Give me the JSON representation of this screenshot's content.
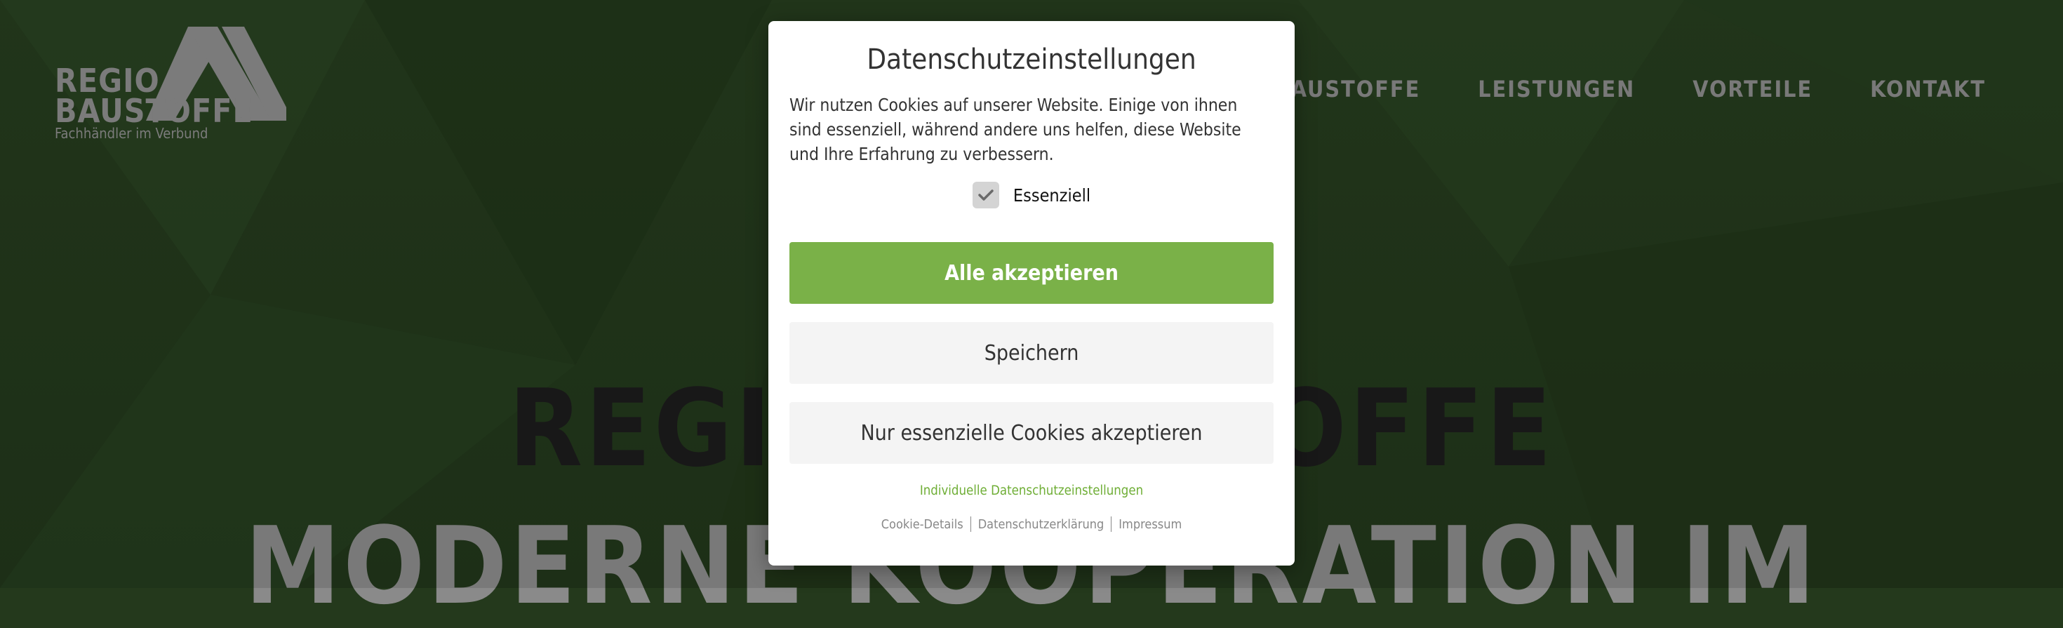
{
  "logo": {
    "line1": "REGIO",
    "line2": "BAUSTOFFE",
    "tagline": "Fachhändler im Verbund",
    "icon": "double-roof-chevron-logo"
  },
  "nav": {
    "items": [
      {
        "label": "REGIO BAUSTOFFE"
      },
      {
        "label": "LEISTUNGEN"
      },
      {
        "label": "VORTEILE"
      },
      {
        "label": "KONTAKT"
      }
    ]
  },
  "hero": {
    "title": "REGIO BAUSTOFFE",
    "subtitle": "MODERNE KOOPERATION IM"
  },
  "cookie_modal": {
    "title": "Datenschutzeinstellungen",
    "text": "Wir nutzen Cookies auf unserer Website. Einige von ihnen sind essenziell, während andere uns helfen, diese Website und Ihre Erfahrung zu verbessern.",
    "checkbox_label": "Essenziell",
    "checkbox_checked": true,
    "checkbox_icon": "checkmark-icon",
    "accept_all": "Alle akzeptieren",
    "save": "Speichern",
    "essential_only": "Nur essenzielle Cookies akzeptieren",
    "individual_settings": "Individuelle Datenschutzeinstellungen",
    "footer_links": [
      "Cookie-Details",
      "Datenschutzerklärung",
      "Impressum"
    ]
  },
  "colors": {
    "background": "#24391c",
    "accent_green": "#7ab148",
    "link_green": "#6fae36",
    "nav_gray": "#8a8a8a"
  }
}
